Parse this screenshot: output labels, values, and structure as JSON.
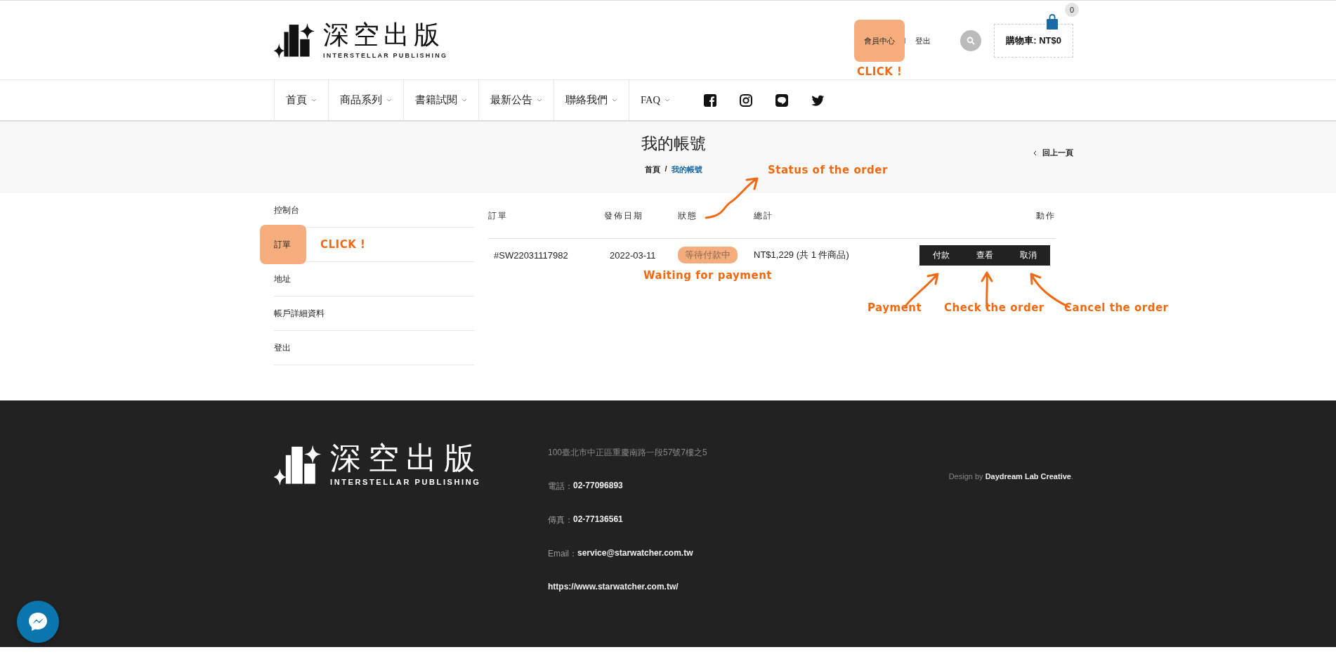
{
  "header": {
    "logo": {
      "name": "深空出版",
      "tagline": "INTERSTELLAR PUBLISHING"
    },
    "links": [
      {
        "label": "會員中心",
        "highlighted": true,
        "callout": "CLICK !"
      },
      {
        "label": "登出",
        "highlighted": false
      }
    ],
    "cart": {
      "label": "購物車: NT$0",
      "count": "0"
    }
  },
  "nav": [
    {
      "label": "首頁"
    },
    {
      "label": "商品系列"
    },
    {
      "label": "書籍試閱"
    },
    {
      "label": "最新公告"
    },
    {
      "label": "聯絡我們"
    },
    {
      "label": "FAQ"
    }
  ],
  "social": [
    {
      "kind": "facebook"
    },
    {
      "kind": "instagram"
    },
    {
      "kind": "chat"
    },
    {
      "kind": "twitter"
    }
  ],
  "page_title": "我的帳號",
  "breadcrumb": [
    {
      "label": "首頁",
      "current": false
    },
    {
      "label": "我的帳號",
      "current": true
    }
  ],
  "breadcrumb_separator": "/",
  "back_link": "回上一頁",
  "sidebar": [
    {
      "label": "控制台",
      "highlighted": false
    },
    {
      "label": "訂單",
      "highlighted": true,
      "callout": "CLICK !"
    },
    {
      "label": "地址",
      "highlighted": false
    },
    {
      "label": "帳戶詳細資料",
      "highlighted": false
    },
    {
      "label": "登出",
      "highlighted": false
    }
  ],
  "orders": {
    "columns": [
      {
        "label": "訂單"
      },
      {
        "label": "發佈日期"
      },
      {
        "label": "狀態",
        "callout": "Status of the order"
      },
      {
        "label": "總計"
      },
      {
        "label": "動作"
      }
    ],
    "rows": [
      {
        "order": "#SW22031117982",
        "date": "2022-03-11",
        "status": "等待付款中",
        "status_highlighted": true,
        "status_callout": "Waiting for payment",
        "total": "NT$1,229 (共 1 件商品)",
        "actions": [
          {
            "label": "付款",
            "callout": "Payment"
          },
          {
            "label": "查看",
            "callout": "Check the order"
          },
          {
            "label": "取消",
            "callout": "Cancel the order"
          }
        ]
      }
    ]
  },
  "footer": {
    "logo": {
      "name": "深空出版",
      "tagline": "INTERSTELLAR PUBLISHING"
    },
    "address": "100臺北市中正區重慶南路一段57號7樓之5",
    "contacts": [
      {
        "label": "電話：",
        "value": "02-77096893"
      },
      {
        "label": "傳真：",
        "value": "02-77136561"
      },
      {
        "label": "Email：",
        "value": "service@starwatcher.com.tw"
      }
    ],
    "website": "https://www.starwatcher.com.tw/",
    "credit": {
      "prefix": "Design by ",
      "link": "Daydream Lab Creative",
      "suffix": "."
    }
  }
}
